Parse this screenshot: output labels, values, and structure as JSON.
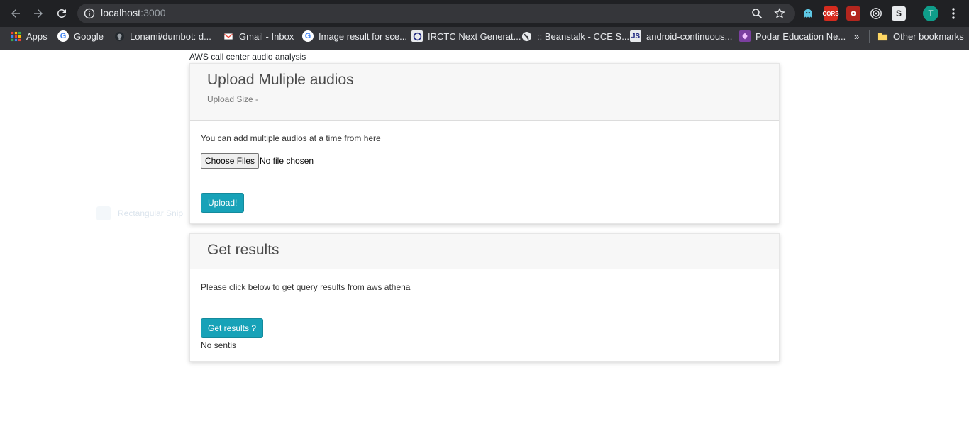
{
  "browser": {
    "url_host": "localhost",
    "url_port": ":3000",
    "avatar_letter": "T",
    "extensions": [
      "ghost-extension",
      "cors-extension",
      "puzzle-extension",
      "target-extension",
      "s-extension"
    ],
    "bookmarks": [
      {
        "label": "Apps",
        "icon": "apps-grid-icon"
      },
      {
        "label": "Google",
        "icon": "google-icon"
      },
      {
        "label": "Lonami/dumbot: d...",
        "icon": "github-icon"
      },
      {
        "label": "Gmail - Inbox",
        "icon": "gmail-icon"
      },
      {
        "label": "Image result for sce...",
        "icon": "google-icon"
      },
      {
        "label": "IRCTC Next Generat...",
        "icon": "irctc-icon"
      },
      {
        "label": ":: Beanstalk - CCE S...",
        "icon": "globe-icon"
      },
      {
        "label": "android-continuous...",
        "icon": "site-icon"
      },
      {
        "label": "Podar Education Ne...",
        "icon": "podar-icon"
      }
    ],
    "overflow_label": "»",
    "other_bookmarks_label": "Other bookmarks"
  },
  "page": {
    "app_title": "AWS call center audio analysis",
    "upload_card": {
      "title": "Upload Muliple audios",
      "subtitle": "Upload Size -",
      "description": "You can add multiple audios at a time from here",
      "choose_files_label": "Choose Files",
      "file_status": "No file chosen",
      "upload_button_label": "Upload!"
    },
    "results_card": {
      "title": "Get results",
      "description": "Please click below to get query results from aws athena",
      "results_button_label": "Get results ?",
      "results_text": "No sentis"
    },
    "ghost_overlay_label": "Rectangular Snip"
  },
  "colors": {
    "accent": "#17a2b8",
    "toolbar_bg": "#202124",
    "bookmarks_bg": "#35363a",
    "card_header_bg": "#f7f7f7"
  }
}
